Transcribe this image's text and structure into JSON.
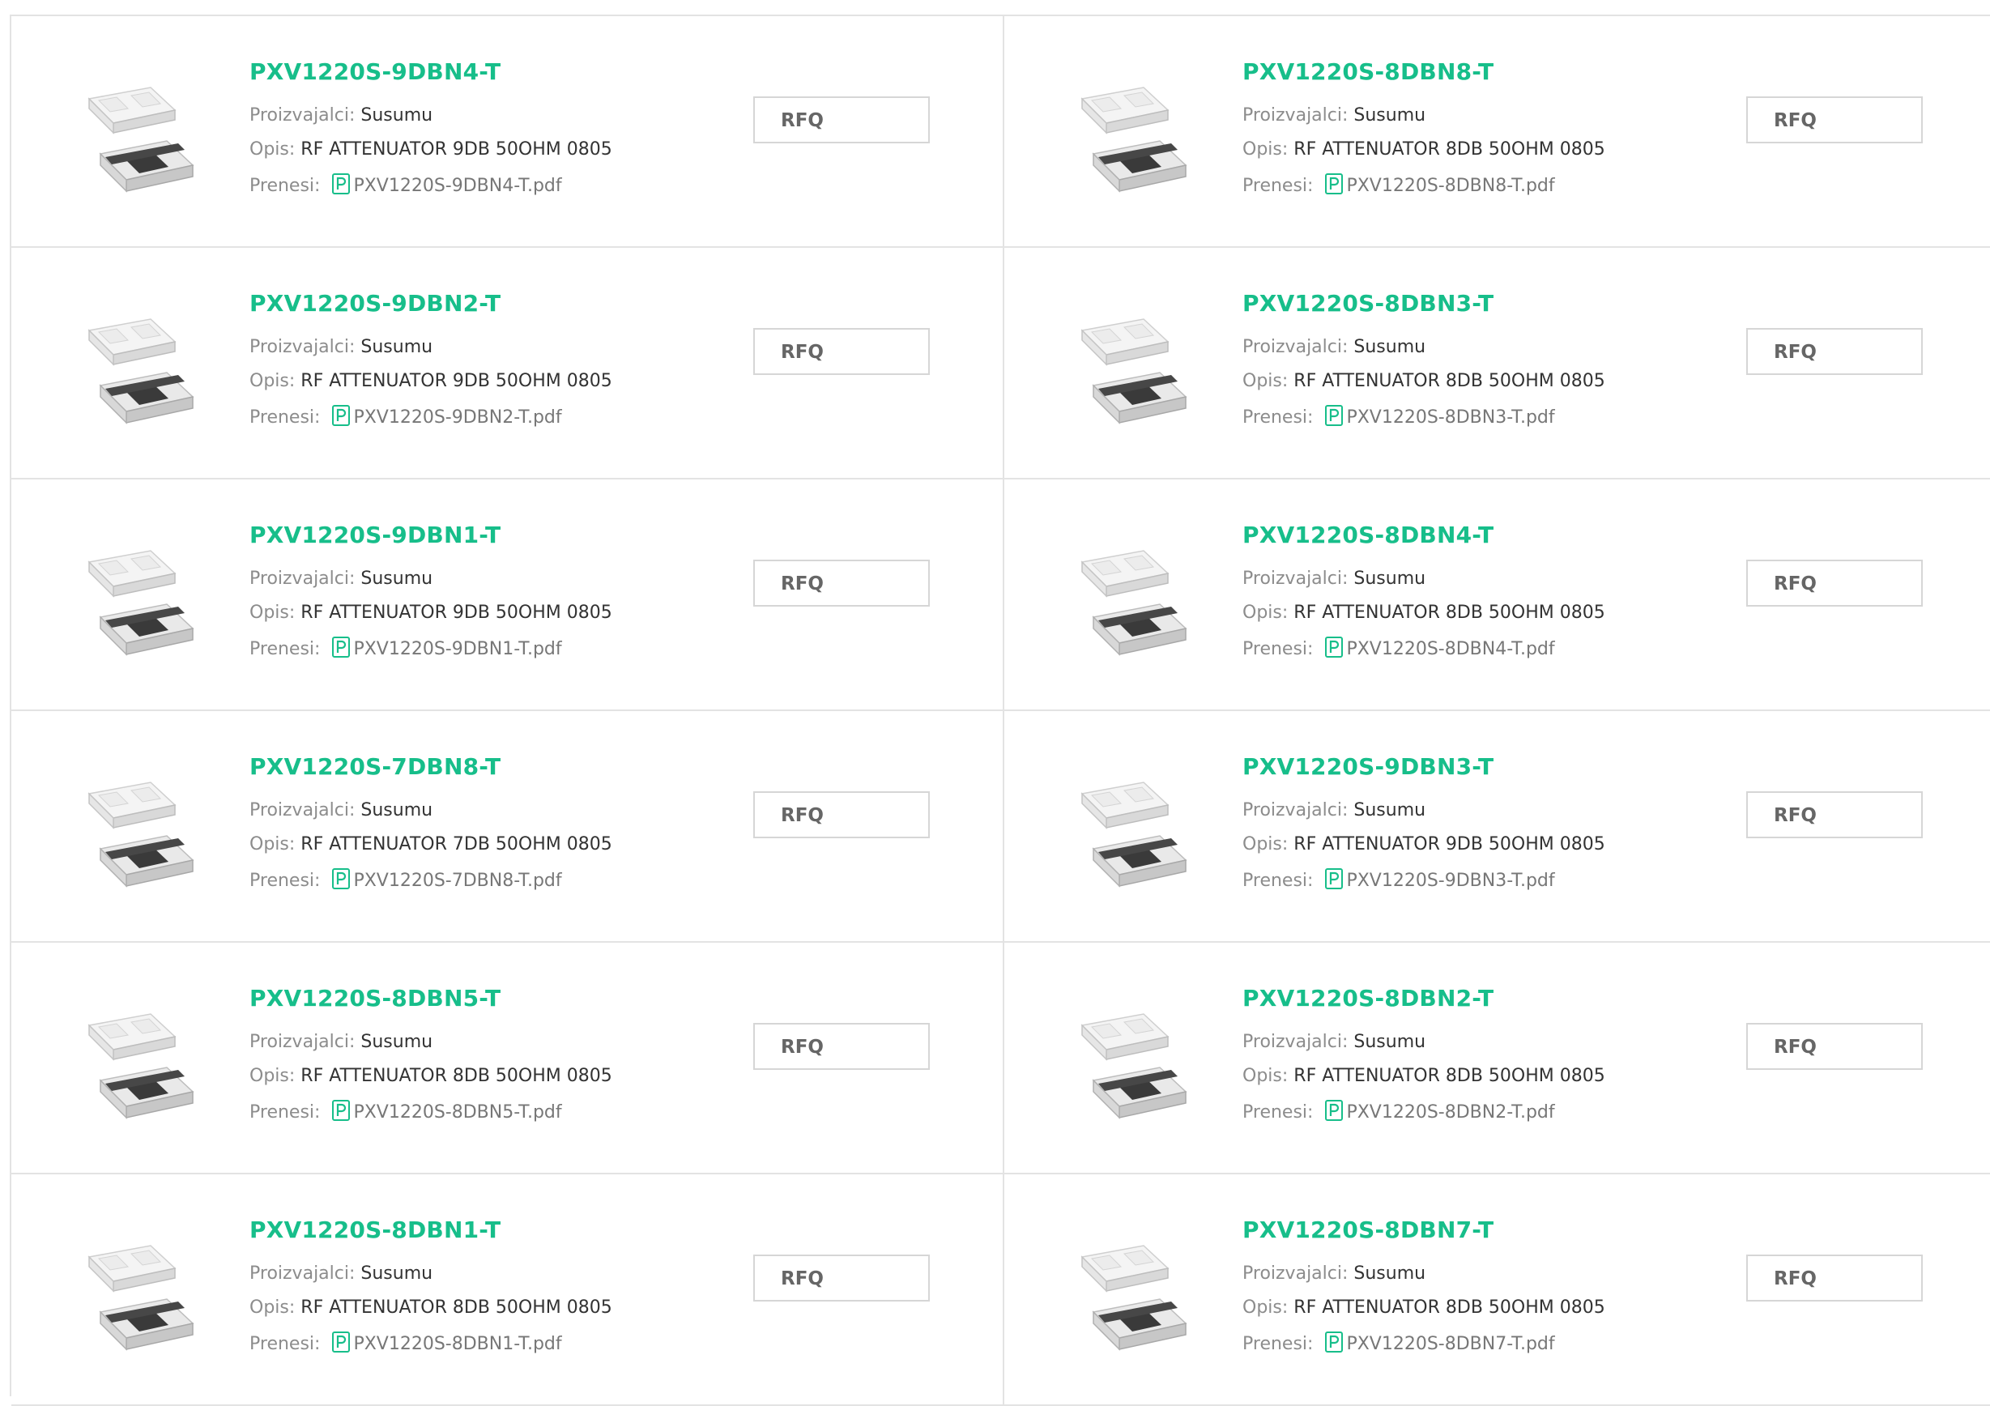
{
  "labels": {
    "manufacturer": "Proizvajalci:",
    "description": "Opis:",
    "download": "Prenesi:",
    "rfq": "RFQ"
  },
  "colors": {
    "title_green": "#17be8a",
    "label_gray": "#8c8c8c",
    "border": "#e3e3e3"
  },
  "products": [
    {
      "part": "PXV1220S-9DBN4-T",
      "manufacturer": "Susumu",
      "description": "RF ATTENUATOR 9DB 50OHM 0805",
      "file": "PXV1220S-9DBN4-T.pdf"
    },
    {
      "part": "PXV1220S-8DBN8-T",
      "manufacturer": "Susumu",
      "description": "RF ATTENUATOR 8DB 50OHM 0805",
      "file": "PXV1220S-8DBN8-T.pdf"
    },
    {
      "part": "PXV1220S-9DBN2-T",
      "manufacturer": "Susumu",
      "description": "RF ATTENUATOR 9DB 50OHM 0805",
      "file": "PXV1220S-9DBN2-T.pdf"
    },
    {
      "part": "PXV1220S-8DBN3-T",
      "manufacturer": "Susumu",
      "description": "RF ATTENUATOR 8DB 50OHM 0805",
      "file": "PXV1220S-8DBN3-T.pdf"
    },
    {
      "part": "PXV1220S-9DBN1-T",
      "manufacturer": "Susumu",
      "description": "RF ATTENUATOR 9DB 50OHM 0805",
      "file": "PXV1220S-9DBN1-T.pdf"
    },
    {
      "part": "PXV1220S-8DBN4-T",
      "manufacturer": "Susumu",
      "description": "RF ATTENUATOR 8DB 50OHM 0805",
      "file": "PXV1220S-8DBN4-T.pdf"
    },
    {
      "part": "PXV1220S-7DBN8-T",
      "manufacturer": "Susumu",
      "description": "RF ATTENUATOR 7DB 50OHM 0805",
      "file": "PXV1220S-7DBN8-T.pdf"
    },
    {
      "part": "PXV1220S-9DBN3-T",
      "manufacturer": "Susumu",
      "description": "RF ATTENUATOR 9DB 50OHM 0805",
      "file": "PXV1220S-9DBN3-T.pdf"
    },
    {
      "part": "PXV1220S-8DBN5-T",
      "manufacturer": "Susumu",
      "description": "RF ATTENUATOR 8DB 50OHM 0805",
      "file": "PXV1220S-8DBN5-T.pdf"
    },
    {
      "part": "PXV1220S-8DBN2-T",
      "manufacturer": "Susumu",
      "description": "RF ATTENUATOR 8DB 50OHM 0805",
      "file": "PXV1220S-8DBN2-T.pdf"
    },
    {
      "part": "PXV1220S-8DBN1-T",
      "manufacturer": "Susumu",
      "description": "RF ATTENUATOR 8DB 50OHM 0805",
      "file": "PXV1220S-8DBN1-T.pdf"
    },
    {
      "part": "PXV1220S-8DBN7-T",
      "manufacturer": "Susumu",
      "description": "RF ATTENUATOR 8DB 50OHM 0805",
      "file": "PXV1220S-8DBN7-T.pdf"
    }
  ]
}
